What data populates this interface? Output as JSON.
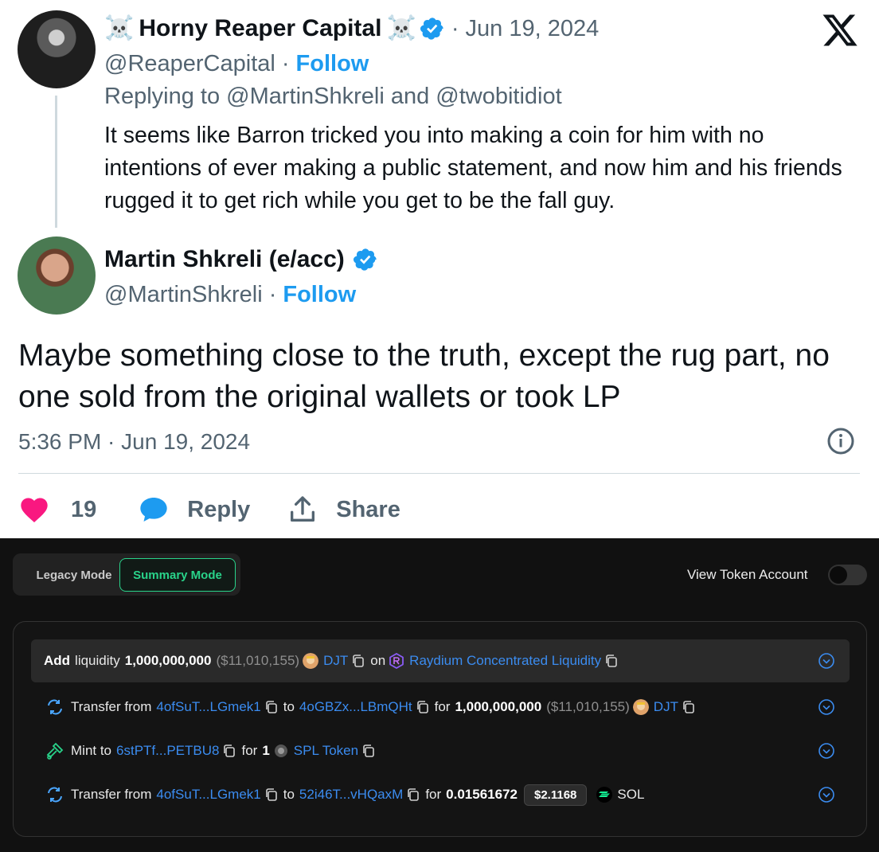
{
  "tweet": {
    "reply": {
      "name_prefix_emoji": "☠️",
      "display_name": "Horny Reaper Capital",
      "name_suffix_emoji": "☠️",
      "date": "· Jun 19, 2024",
      "handle": "@ReaperCapital ·",
      "follow": "Follow",
      "replying_to": "Replying to @MartinShkreli and @twobitidiot",
      "text": "It seems like Barron tricked you into making a coin for him with no intentions of ever making a public statement, and now him and his friends rugged it to get rich while you get to be the fall guy."
    },
    "main": {
      "display_name": "Martin Shkreli (e/acc)",
      "handle": "@MartinShkreli ·",
      "follow": "Follow",
      "text": "Maybe something close to the truth, except the rug part, no one sold from the original wallets or took LP",
      "timestamp": "5:36 PM · Jun 19, 2024"
    },
    "actions": {
      "like_count": "19",
      "reply_label": "Reply",
      "share_label": "Share"
    },
    "colors": {
      "accent": "#1d9bf0",
      "like": "#f91880",
      "muted": "#536471"
    }
  },
  "explorer": {
    "modes": {
      "legacy": "Legacy Mode",
      "summary": "Summary Mode"
    },
    "view_token_account": "View Token Account",
    "view_token_account_enabled": false,
    "rows": [
      {
        "action": "Add",
        "p1": "liquidity",
        "amount": "1,000,000,000",
        "usd": "($11,010,155)",
        "token": "DJT",
        "p2": "on",
        "platform": "Raydium Concentrated Liquidity"
      },
      {
        "p1": "Transfer from",
        "from": "4ofSuT...LGmek1",
        "p2": "to",
        "to": "4oGBZx...LBmQHt",
        "p3": "for",
        "amount": "1,000,000,000",
        "usd": "($11,010,155)",
        "token": "DJT"
      },
      {
        "p1": "Mint to",
        "to": "6stPTf...PETBU8",
        "p2": "for",
        "amount": "1",
        "token": "SPL Token"
      },
      {
        "p1": "Transfer from",
        "from": "4ofSuT...LGmek1",
        "p2": "to",
        "to": "52i46T...vHQaxM",
        "p3": "for",
        "amount": "0.01561672",
        "usd_pill": "$2.1168",
        "token": "SOL"
      }
    ],
    "colors": {
      "green": "#29d38a",
      "link": "#3b8cf0"
    }
  }
}
